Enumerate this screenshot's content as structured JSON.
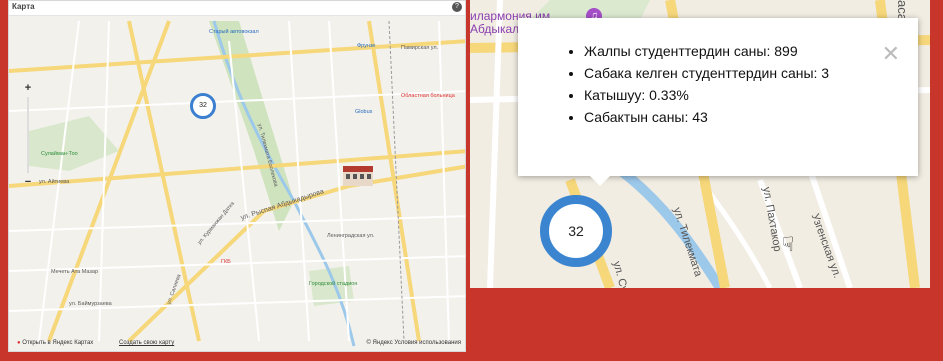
{
  "left_map": {
    "header_title": "Карта",
    "zoom_in": "+",
    "zoom_out": "−",
    "cluster_count": "32",
    "footer": {
      "open_in": "Открыть в Яндекс Картах",
      "create": "Создать свою карту",
      "copyright": "© Яндекс Условия использования"
    },
    "labels": {
      "stary_avtovokzal": "Старый автовокзал",
      "frunze": "Фрунзе",
      "pamir": "Памирская ул.",
      "globus": "Globus",
      "hospital": "Областная больница",
      "sulaiman": "Сулайман-Тоо",
      "aitieva": "ул. Айтиева",
      "kurmanjan": "ул. Курманжан Датка",
      "abdykadyrov": "ул. Рыспая Абдыкадырова",
      "lenin": "Ленинградская ул.",
      "stadium": "Городской стадион",
      "gkb": "ГКБ",
      "mechet": "Мечеть Ата Мазар",
      "baymurzaev": "ул. Баймурзаева",
      "tilekmat": "ул. Тилекмата Боолекова",
      "salieva": "ул. Салиева"
    }
  },
  "right_map": {
    "philharmonic": "илармония им.\nАбдыкалыкова",
    "popup_items": [
      "Жалпы студенттердин саны: 899",
      "Сабака келген студенттердин саны: 3",
      "Катышуу: 0.33%",
      "Сабактын саны: 43"
    ],
    "cluster_count": "32",
    "street_tilekmat": "ул. Тилекмата",
    "street_pakhtakor": "ул. Пахтакор",
    "street_uzgen": "Узгенская ул.",
    "street_su": "ул. Су",
    "top_right": "аса"
  },
  "colors": {
    "background": "#c8362b",
    "cluster": "#3b85d0"
  }
}
